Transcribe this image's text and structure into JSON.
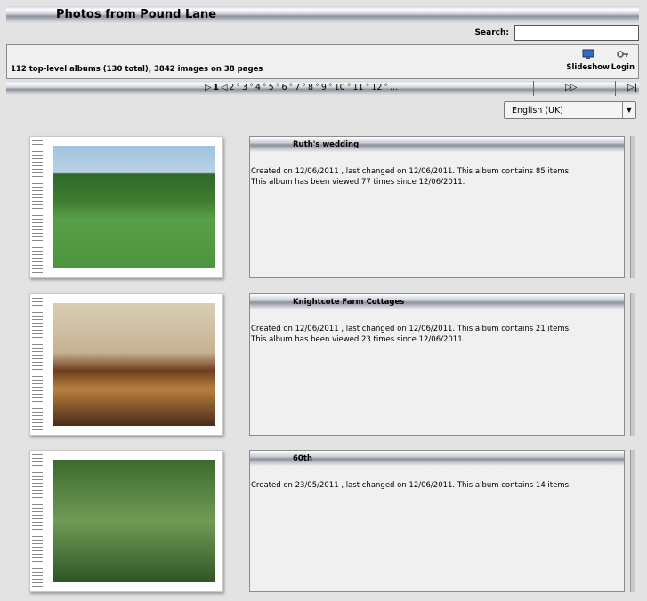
{
  "header": {
    "title": "Photos from Pound Lane"
  },
  "search": {
    "label": "Search:",
    "value": ""
  },
  "info": {
    "summary": "112 top-level albums (130 total), 3842 images on 38 pages",
    "slideshow_label": "Slideshow",
    "login_label": "Login",
    "slideshow_icon": "monitor-icon",
    "login_icon": "key-icon"
  },
  "pager": {
    "first_arrow": "▷",
    "current": "1",
    "prev_arrow": "◁",
    "pages": [
      "2",
      "3",
      "4",
      "5",
      "6",
      "7",
      "8",
      "9",
      "10",
      "11",
      "12"
    ],
    "separator": "°",
    "ellipsis": "...",
    "next": "▷▷",
    "last": "▷|"
  },
  "language": {
    "selected": "English (UK)",
    "arrow": "▼"
  },
  "albums": [
    {
      "title": "Ruth's wedding",
      "line1": "Created on 12/06/2011 , last changed on 12/06/2011. This album contains 85 items.",
      "line2": "This album has been viewed 77 times since 12/06/2011."
    },
    {
      "title": "Knightcote Farm Cottages",
      "line1": "Created on 12/06/2011 , last changed on 12/06/2011. This album contains 21 items.",
      "line2": "This album has been viewed 23 times since 12/06/2011."
    },
    {
      "title": "60th",
      "line1": "Created on 23/05/2011 , last changed on 12/06/2011. This album contains 14 items.",
      "line2": ""
    }
  ]
}
